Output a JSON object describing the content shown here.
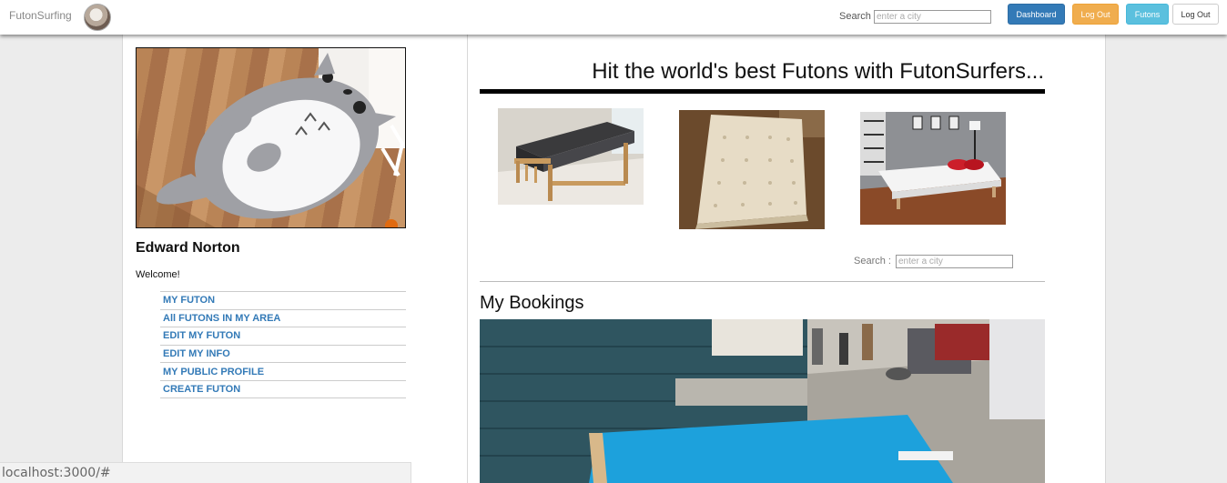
{
  "navbar": {
    "brand": "FutonSurfing",
    "search_label": "Search",
    "search_placeholder": "enter a city",
    "buttons": {
      "dashboard": "Dashboard",
      "logout_orange": "Log Out",
      "futons": "Futons",
      "logout_plain": "Log Out"
    }
  },
  "profile": {
    "name": "Edward Norton",
    "welcome": "Welcome!",
    "menu": [
      "MY FUTON",
      "All FUTONS IN MY AREA",
      "EDIT MY FUTON",
      "EDIT MY INFO",
      "MY PUBLIC PROFILE",
      "CREATE FUTON"
    ]
  },
  "main": {
    "hero_title": "Hit the world's best Futons with FutonSurfers...",
    "search_label": "Search :",
    "search_placeholder": "enter a city",
    "bookings_heading": "My Bookings"
  },
  "statusbar": {
    "url": "localhost:3000/#"
  },
  "colors": {
    "primary": "#337ab7",
    "warning": "#f0ad4e",
    "info": "#5bc0de",
    "link": "#337ab7"
  }
}
